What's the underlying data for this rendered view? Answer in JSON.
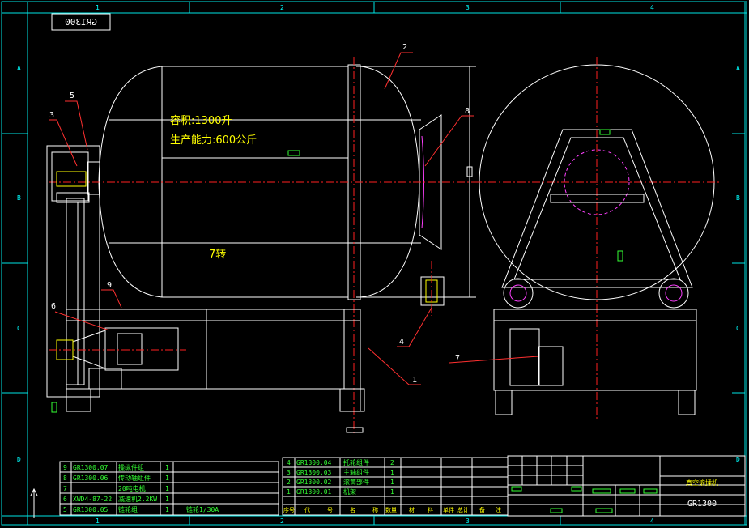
{
  "colors": {
    "background": "#000000",
    "border": "#00e5e5",
    "geometry": "#ffffff",
    "centerline": "#ff2020",
    "callout": "#ff3030",
    "annotation": "#ffff00",
    "table_text": "#33ff33",
    "accent": "#ff40ff"
  },
  "frame": {
    "columns": [
      "1",
      "2",
      "3",
      "4"
    ],
    "rows": [
      "A",
      "B",
      "C",
      "D"
    ],
    "stamp": "GR1300"
  },
  "annotations": {
    "capacity": "容积:1300升",
    "output": "生产能力:600公斤",
    "count": "7转"
  },
  "callouts": [
    "1",
    "2",
    "3",
    "4",
    "5",
    "6",
    "7",
    "8",
    "9"
  ],
  "bom_left": [
    {
      "no": "9",
      "code": "GR1300.07",
      "name": "操纵件组",
      "qty": "1"
    },
    {
      "no": "8",
      "code": "GR1300.06",
      "name": "传动轴组件",
      "qty": "1"
    },
    {
      "no": "7",
      "code": "",
      "name": "20吨电机",
      "qty": "1"
    },
    {
      "no": "6",
      "code": "XWD4-87-22",
      "name": "减速机2.2KW",
      "qty": "1"
    },
    {
      "no": "5",
      "code": "GR1300.05",
      "name": "链轮组",
      "qty": "1",
      "note": "链轮1/30A"
    }
  ],
  "bom_right": [
    {
      "no": "4",
      "code": "GR1300.04",
      "name": "托轮组件",
      "qty": "2"
    },
    {
      "no": "3",
      "code": "GR1300.03",
      "name": "主轴组件",
      "qty": "1"
    },
    {
      "no": "2",
      "code": "GR1300.02",
      "name": "滚筒部件",
      "qty": "1"
    },
    {
      "no": "1",
      "code": "GR1300.01",
      "name": "机架",
      "qty": "1"
    }
  ],
  "bom_header": [
    "序号",
    "代",
    "号",
    "名",
    "称",
    "数量",
    "材",
    "料",
    "单件",
    "总计",
    "备",
    "注"
  ],
  "title_block": {
    "product": "真空滚揉机",
    "drawing_no": "GR1300"
  }
}
